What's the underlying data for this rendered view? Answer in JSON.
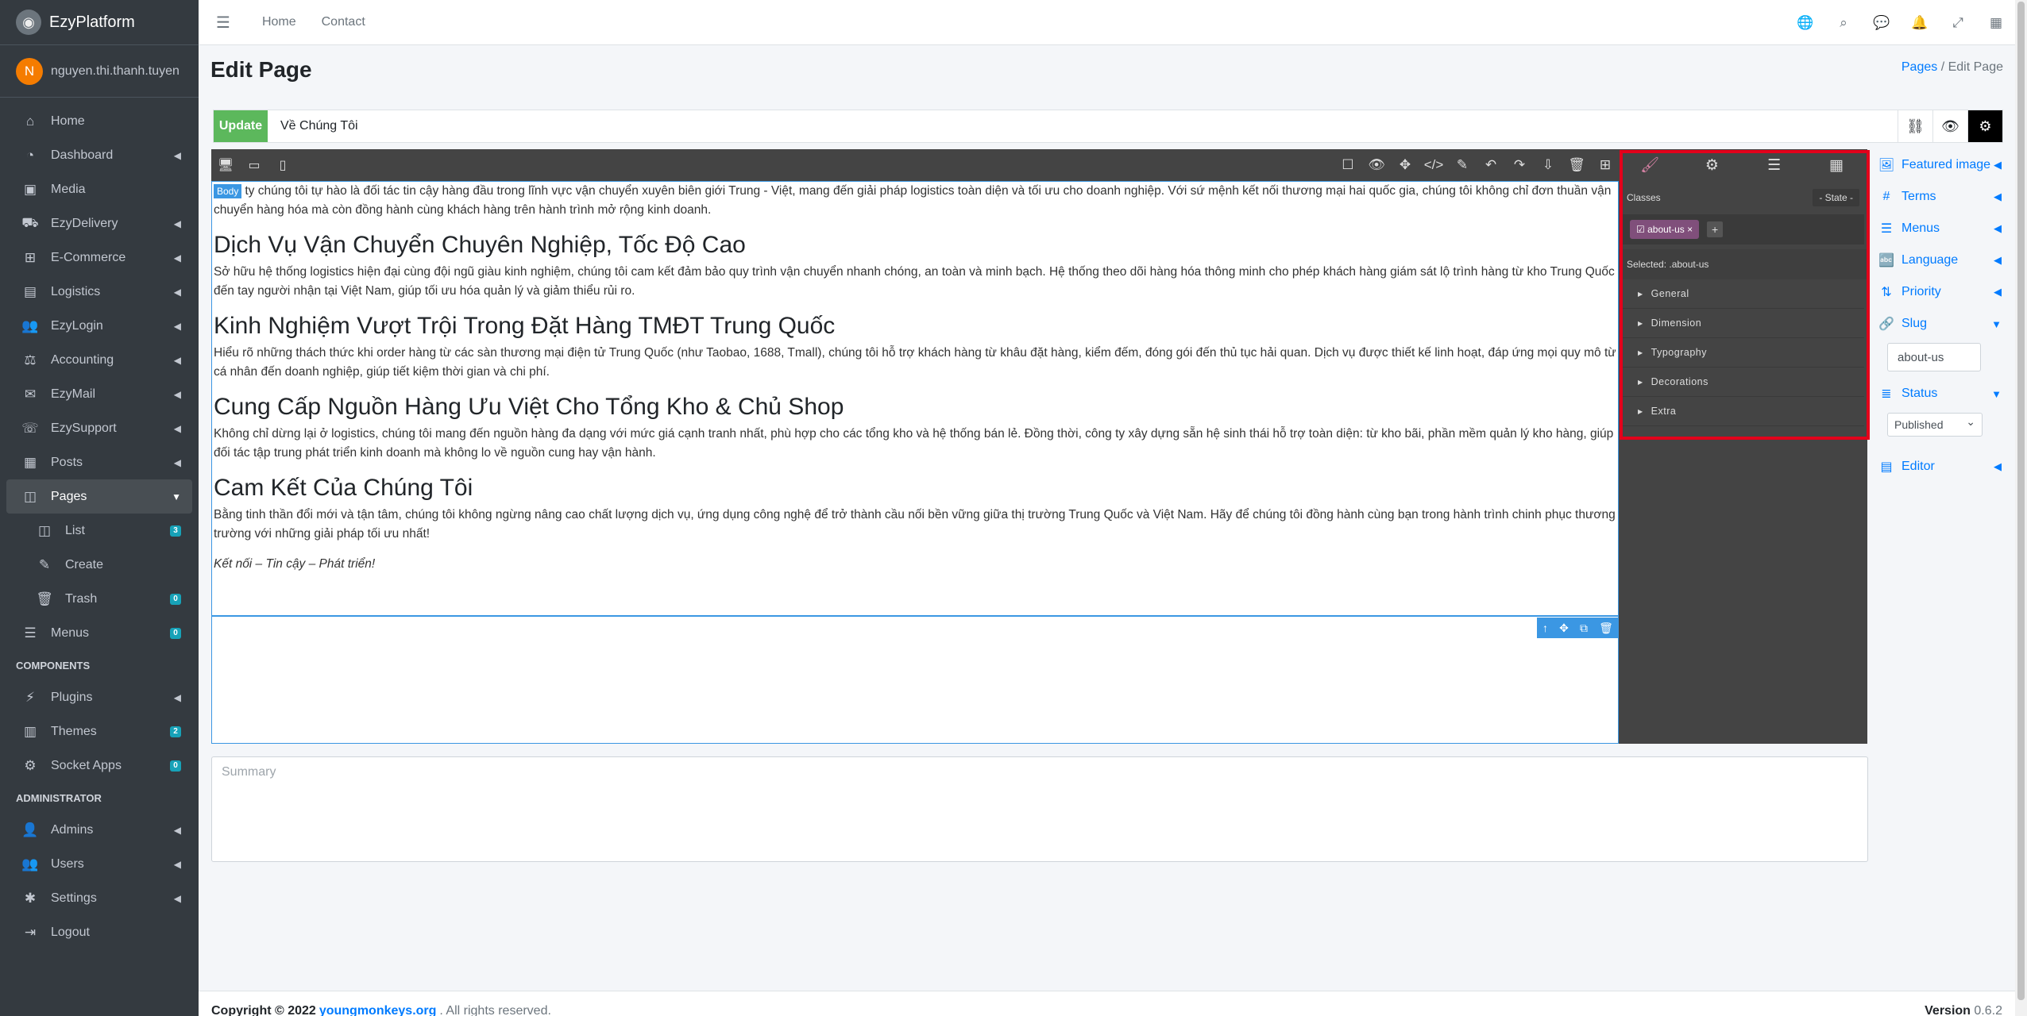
{
  "brand": {
    "name": "EzyPlatform",
    "logo_icon": "ezyplatform-logo-icon"
  },
  "user": {
    "initial": "N",
    "name": "nguyen.thi.thanh.tuyen",
    "avatar_color": "#f57c00"
  },
  "sidebar": {
    "items": [
      {
        "label": "Home",
        "icon": "home-icon"
      },
      {
        "label": "Dashboard",
        "icon": "dashboard-icon"
      },
      {
        "label": "Media",
        "icon": "media-icon"
      },
      {
        "label": "EzyDelivery",
        "icon": "truck-icon"
      },
      {
        "label": "E-Commerce",
        "icon": "cart-icon"
      },
      {
        "label": "Logistics",
        "icon": "logistics-icon"
      },
      {
        "label": "EzyLogin",
        "icon": "users-icon"
      },
      {
        "label": "Accounting",
        "icon": "accounting-icon"
      },
      {
        "label": "EzyMail",
        "icon": "mail-icon"
      },
      {
        "label": "EzySupport",
        "icon": "support-icon"
      },
      {
        "label": "Posts",
        "icon": "posts-icon"
      },
      {
        "label": "Pages",
        "icon": "pages-icon"
      },
      {
        "label": "List",
        "icon": "list-icon",
        "badge": "3"
      },
      {
        "label": "Create",
        "icon": "edit-icon"
      },
      {
        "label": "Trash",
        "icon": "trash-icon",
        "badge": "0"
      },
      {
        "label": "Menus",
        "icon": "menus-icon",
        "badge": "0"
      }
    ],
    "components_header": "COMPONENTS",
    "components": [
      {
        "label": "Plugins",
        "icon": "plug-icon"
      },
      {
        "label": "Themes",
        "icon": "themes-icon",
        "badge": "2"
      },
      {
        "label": "Socket Apps",
        "icon": "socket-icon",
        "badge": "0"
      }
    ],
    "admin_header": "ADMINISTRATOR",
    "admin": [
      {
        "label": "Admins",
        "icon": "admin-icon"
      },
      {
        "label": "Users",
        "icon": "users-icon"
      },
      {
        "label": "Settings",
        "icon": "gear-icon"
      },
      {
        "label": "Logout",
        "icon": "logout-icon"
      }
    ]
  },
  "topbar": {
    "home": "Home",
    "contact": "Contact"
  },
  "page": {
    "title": "Edit Page",
    "breadcrumb_pages": "Pages",
    "breadcrumb_sep": "/",
    "breadcrumb_current": "Edit Page"
  },
  "editor": {
    "update_label": "Update",
    "page_title_value": "Về Chúng Tôi",
    "body_badge": "Body",
    "intro": "ty chúng tôi tự hào là đối tác tin cậy hàng đầu trong lĩnh vực vận chuyển xuyên biên giới Trung - Việt, mang đến giải pháp logistics toàn diện và tối ưu cho doanh nghiệp. Với sứ mệnh kết nối thương mại hai quốc gia, chúng tôi không chỉ đơn thuần vận chuyển hàng hóa mà còn đồng hành cùng khách hàng trên hành trình mở rộng kinh doanh.",
    "h1": "Dịch Vụ Vận Chuyển Chuyên Nghiệp, Tốc Độ Cao",
    "p1": "Sở hữu hệ thống logistics hiện đại cùng đội ngũ giàu kinh nghiệm, chúng tôi cam kết đảm bảo quy trình vận chuyển nhanh chóng, an toàn và minh bạch. Hệ thống theo dõi hàng hóa thông minh cho phép khách hàng giám sát lộ trình hàng từ kho Trung Quốc đến tay người nhận tại Việt Nam, giúp tối ưu hóa quản lý và giảm thiểu rủi ro.",
    "h2": "Kinh Nghiệm Vượt Trội Trong Đặt Hàng TMĐT Trung Quốc",
    "p2": "Hiểu rõ những thách thức khi order hàng từ các sàn thương mại điện tử Trung Quốc (như Taobao, 1688, Tmall), chúng tôi hỗ trợ khách hàng từ khâu đặt hàng, kiểm đếm, đóng gói đến thủ tục hải quan. Dịch vụ được thiết kế linh hoạt, đáp ứng mọi quy mô từ cá nhân đến doanh nghiệp, giúp tiết kiệm thời gian và chi phí.",
    "h3": "Cung Cấp Nguồn Hàng Ưu Việt Cho Tổng Kho & Chủ Shop",
    "p3": "Không chỉ dừng lại ở logistics, chúng tôi mang đến nguồn hàng đa dạng với mức giá cạnh tranh nhất, phù hợp cho các tổng kho và hệ thống bán lẻ. Đồng thời, công ty xây dựng sẵn hệ sinh thái hỗ trợ toàn diện: từ kho bãi, phần mềm quản lý kho hàng, giúp đối tác tập trung phát triển kinh doanh mà không lo về nguồn cung hay vận hành.",
    "h4": "Cam Kết Của Chúng Tôi",
    "p4": "Bằng tinh thần đổi mới và tận tâm, chúng tôi không ngừng nâng cao chất lượng dịch vụ, ứng dụng công nghệ để trở thành cầu nối bền vững giữa thị trường Trung Quốc và Việt Nam. Hãy để chúng tôi đồng hành cùng bạn trong hành trình chinh phục thương trường với những giải pháp tối ưu nhất!",
    "tagline": "Kết nối – Tin cậy – Phát triển!"
  },
  "style_manager": {
    "classes_label": "Classes",
    "state_label": "- State -",
    "tag": "about-us",
    "add": "+",
    "selected": "Selected: .about-us",
    "sectors": [
      "General",
      "Dimension",
      "Typography",
      "Decorations",
      "Extra"
    ],
    "accent": "#d983a6",
    "outline_color": "#e3001b"
  },
  "meta": {
    "featured_image": "Featured image",
    "terms": "Terms",
    "menus": "Menus",
    "language": "Language",
    "priority": "Priority",
    "slug": "Slug",
    "slug_value": "about-us",
    "status": "Status",
    "status_value": "Published",
    "editor": "Editor"
  },
  "summary_placeholder": "Summary",
  "footer": {
    "copyright": "Copyright © 2022",
    "link": "youngmonkeys.org",
    "rights": ". All rights reserved.",
    "version_label": "Version",
    "version": "0.6.2"
  }
}
